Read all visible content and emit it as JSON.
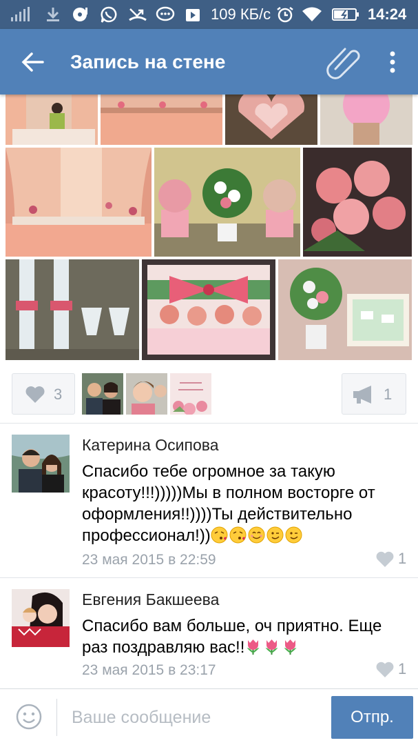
{
  "statusbar": {
    "speed": "109 КБ/с",
    "time": "14:24"
  },
  "appbar": {
    "title": "Запись на стене",
    "icons": [
      "back-arrow-icon",
      "paperclip-icon",
      "more-vertical-icon"
    ]
  },
  "actions": {
    "likes_count": "3",
    "shares_count": "1"
  },
  "comments": [
    {
      "author": "Катерина Осипова",
      "text": "Спасибо тебе огромное за такую красоту!!!)))))Мы в полном восторге от оформления!!))))Ты действительно профессионал!))",
      "emojis": [
        "😘",
        "😘",
        "😊",
        "😉",
        "😉"
      ],
      "date": "23 мая 2015 в 22:59",
      "likes": "1"
    },
    {
      "author": "Евгения Бакшеева",
      "text": "Спасибо вам больше, оч приятно. Еще раз поздравляю вас!!",
      "emojis": [
        "🌷",
        "🌷",
        "🌷"
      ],
      "date": "23 мая 2015 в 23:17",
      "likes": "1"
    }
  ],
  "composer": {
    "placeholder": "Ваше сообщение",
    "send_label": "Отпр."
  },
  "colors": {
    "statusbar": "#3f5f85",
    "appbar": "#5181b8",
    "accent": "#5181b8",
    "muted": "#9aa2ab"
  }
}
